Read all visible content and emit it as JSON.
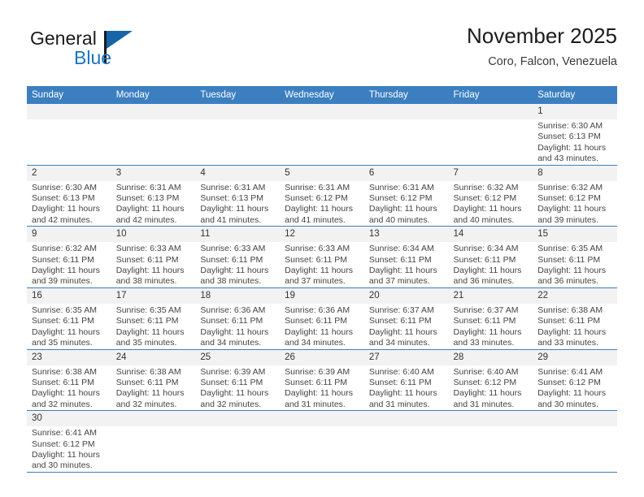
{
  "brand": {
    "name_part1": "General",
    "name_part2": "Blue",
    "flag_icon": "blue-triangle-flag-icon",
    "accent_color": "#1874c4"
  },
  "header": {
    "title": "November 2025",
    "subtitle": "Coro, Falcon, Venezuela"
  },
  "theme": {
    "header_row_bg": "#3c7fc1",
    "daynum_bg": "#f2f2f2",
    "grid_line": "#3c7fc1",
    "text": "#444444"
  },
  "weekdays": [
    "Sunday",
    "Monday",
    "Tuesday",
    "Wednesday",
    "Thursday",
    "Friday",
    "Saturday"
  ],
  "labels": {
    "sunrise": "Sunrise:",
    "sunset": "Sunset:",
    "daylight": "Daylight:"
  },
  "weeks": [
    [
      {
        "empty": true
      },
      {
        "empty": true
      },
      {
        "empty": true
      },
      {
        "empty": true
      },
      {
        "empty": true
      },
      {
        "empty": true
      },
      {
        "day": "1",
        "sunrise": "Sunrise: 6:30 AM",
        "sunset": "Sunset: 6:13 PM",
        "daylight1": "Daylight: 11 hours",
        "daylight2": "and 43 minutes."
      }
    ],
    [
      {
        "day": "2",
        "sunrise": "Sunrise: 6:30 AM",
        "sunset": "Sunset: 6:13 PM",
        "daylight1": "Daylight: 11 hours",
        "daylight2": "and 42 minutes."
      },
      {
        "day": "3",
        "sunrise": "Sunrise: 6:31 AM",
        "sunset": "Sunset: 6:13 PM",
        "daylight1": "Daylight: 11 hours",
        "daylight2": "and 42 minutes."
      },
      {
        "day": "4",
        "sunrise": "Sunrise: 6:31 AM",
        "sunset": "Sunset: 6:13 PM",
        "daylight1": "Daylight: 11 hours",
        "daylight2": "and 41 minutes."
      },
      {
        "day": "5",
        "sunrise": "Sunrise: 6:31 AM",
        "sunset": "Sunset: 6:12 PM",
        "daylight1": "Daylight: 11 hours",
        "daylight2": "and 41 minutes."
      },
      {
        "day": "6",
        "sunrise": "Sunrise: 6:31 AM",
        "sunset": "Sunset: 6:12 PM",
        "daylight1": "Daylight: 11 hours",
        "daylight2": "and 40 minutes."
      },
      {
        "day": "7",
        "sunrise": "Sunrise: 6:32 AM",
        "sunset": "Sunset: 6:12 PM",
        "daylight1": "Daylight: 11 hours",
        "daylight2": "and 40 minutes."
      },
      {
        "day": "8",
        "sunrise": "Sunrise: 6:32 AM",
        "sunset": "Sunset: 6:12 PM",
        "daylight1": "Daylight: 11 hours",
        "daylight2": "and 39 minutes."
      }
    ],
    [
      {
        "day": "9",
        "sunrise": "Sunrise: 6:32 AM",
        "sunset": "Sunset: 6:11 PM",
        "daylight1": "Daylight: 11 hours",
        "daylight2": "and 39 minutes."
      },
      {
        "day": "10",
        "sunrise": "Sunrise: 6:33 AM",
        "sunset": "Sunset: 6:11 PM",
        "daylight1": "Daylight: 11 hours",
        "daylight2": "and 38 minutes."
      },
      {
        "day": "11",
        "sunrise": "Sunrise: 6:33 AM",
        "sunset": "Sunset: 6:11 PM",
        "daylight1": "Daylight: 11 hours",
        "daylight2": "and 38 minutes."
      },
      {
        "day": "12",
        "sunrise": "Sunrise: 6:33 AM",
        "sunset": "Sunset: 6:11 PM",
        "daylight1": "Daylight: 11 hours",
        "daylight2": "and 37 minutes."
      },
      {
        "day": "13",
        "sunrise": "Sunrise: 6:34 AM",
        "sunset": "Sunset: 6:11 PM",
        "daylight1": "Daylight: 11 hours",
        "daylight2": "and 37 minutes."
      },
      {
        "day": "14",
        "sunrise": "Sunrise: 6:34 AM",
        "sunset": "Sunset: 6:11 PM",
        "daylight1": "Daylight: 11 hours",
        "daylight2": "and 36 minutes."
      },
      {
        "day": "15",
        "sunrise": "Sunrise: 6:35 AM",
        "sunset": "Sunset: 6:11 PM",
        "daylight1": "Daylight: 11 hours",
        "daylight2": "and 36 minutes."
      }
    ],
    [
      {
        "day": "16",
        "sunrise": "Sunrise: 6:35 AM",
        "sunset": "Sunset: 6:11 PM",
        "daylight1": "Daylight: 11 hours",
        "daylight2": "and 35 minutes."
      },
      {
        "day": "17",
        "sunrise": "Sunrise: 6:35 AM",
        "sunset": "Sunset: 6:11 PM",
        "daylight1": "Daylight: 11 hours",
        "daylight2": "and 35 minutes."
      },
      {
        "day": "18",
        "sunrise": "Sunrise: 6:36 AM",
        "sunset": "Sunset: 6:11 PM",
        "daylight1": "Daylight: 11 hours",
        "daylight2": "and 34 minutes."
      },
      {
        "day": "19",
        "sunrise": "Sunrise: 6:36 AM",
        "sunset": "Sunset: 6:11 PM",
        "daylight1": "Daylight: 11 hours",
        "daylight2": "and 34 minutes."
      },
      {
        "day": "20",
        "sunrise": "Sunrise: 6:37 AM",
        "sunset": "Sunset: 6:11 PM",
        "daylight1": "Daylight: 11 hours",
        "daylight2": "and 34 minutes."
      },
      {
        "day": "21",
        "sunrise": "Sunrise: 6:37 AM",
        "sunset": "Sunset: 6:11 PM",
        "daylight1": "Daylight: 11 hours",
        "daylight2": "and 33 minutes."
      },
      {
        "day": "22",
        "sunrise": "Sunrise: 6:38 AM",
        "sunset": "Sunset: 6:11 PM",
        "daylight1": "Daylight: 11 hours",
        "daylight2": "and 33 minutes."
      }
    ],
    [
      {
        "day": "23",
        "sunrise": "Sunrise: 6:38 AM",
        "sunset": "Sunset: 6:11 PM",
        "daylight1": "Daylight: 11 hours",
        "daylight2": "and 32 minutes."
      },
      {
        "day": "24",
        "sunrise": "Sunrise: 6:38 AM",
        "sunset": "Sunset: 6:11 PM",
        "daylight1": "Daylight: 11 hours",
        "daylight2": "and 32 minutes."
      },
      {
        "day": "25",
        "sunrise": "Sunrise: 6:39 AM",
        "sunset": "Sunset: 6:11 PM",
        "daylight1": "Daylight: 11 hours",
        "daylight2": "and 32 minutes."
      },
      {
        "day": "26",
        "sunrise": "Sunrise: 6:39 AM",
        "sunset": "Sunset: 6:11 PM",
        "daylight1": "Daylight: 11 hours",
        "daylight2": "and 31 minutes."
      },
      {
        "day": "27",
        "sunrise": "Sunrise: 6:40 AM",
        "sunset": "Sunset: 6:11 PM",
        "daylight1": "Daylight: 11 hours",
        "daylight2": "and 31 minutes."
      },
      {
        "day": "28",
        "sunrise": "Sunrise: 6:40 AM",
        "sunset": "Sunset: 6:12 PM",
        "daylight1": "Daylight: 11 hours",
        "daylight2": "and 31 minutes."
      },
      {
        "day": "29",
        "sunrise": "Sunrise: 6:41 AM",
        "sunset": "Sunset: 6:12 PM",
        "daylight1": "Daylight: 11 hours",
        "daylight2": "and 30 minutes."
      }
    ],
    [
      {
        "day": "30",
        "sunrise": "Sunrise: 6:41 AM",
        "sunset": "Sunset: 6:12 PM",
        "daylight1": "Daylight: 11 hours",
        "daylight2": "and 30 minutes."
      },
      {
        "empty": true
      },
      {
        "empty": true
      },
      {
        "empty": true
      },
      {
        "empty": true
      },
      {
        "empty": true
      },
      {
        "empty": true
      }
    ]
  ]
}
